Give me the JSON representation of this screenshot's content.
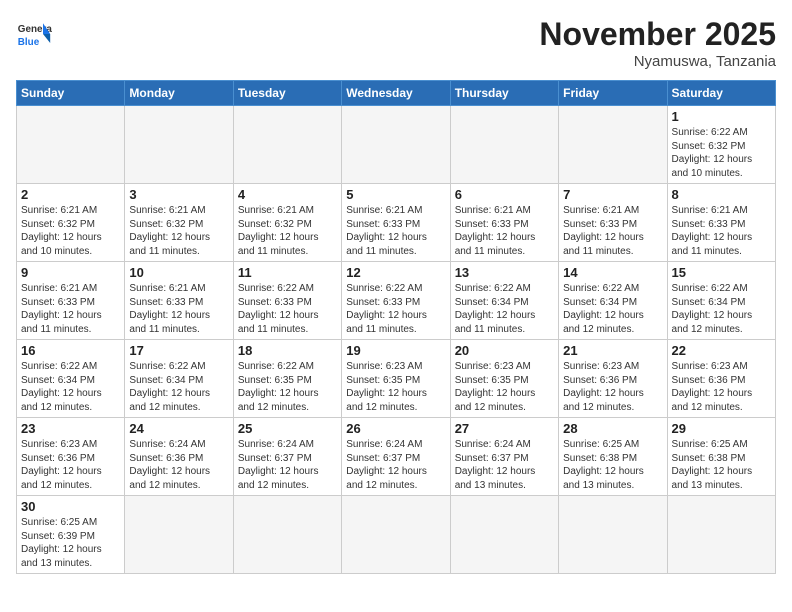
{
  "header": {
    "logo_general": "General",
    "logo_blue": "Blue",
    "month_title": "November 2025",
    "location": "Nyamuswa, Tanzania"
  },
  "weekdays": [
    "Sunday",
    "Monday",
    "Tuesday",
    "Wednesday",
    "Thursday",
    "Friday",
    "Saturday"
  ],
  "weeks": [
    [
      {
        "day": "",
        "info": ""
      },
      {
        "day": "",
        "info": ""
      },
      {
        "day": "",
        "info": ""
      },
      {
        "day": "",
        "info": ""
      },
      {
        "day": "",
        "info": ""
      },
      {
        "day": "",
        "info": ""
      },
      {
        "day": "1",
        "info": "Sunrise: 6:22 AM\nSunset: 6:32 PM\nDaylight: 12 hours and 10 minutes."
      }
    ],
    [
      {
        "day": "2",
        "info": "Sunrise: 6:21 AM\nSunset: 6:32 PM\nDaylight: 12 hours and 10 minutes."
      },
      {
        "day": "3",
        "info": "Sunrise: 6:21 AM\nSunset: 6:32 PM\nDaylight: 12 hours and 11 minutes."
      },
      {
        "day": "4",
        "info": "Sunrise: 6:21 AM\nSunset: 6:32 PM\nDaylight: 12 hours and 11 minutes."
      },
      {
        "day": "5",
        "info": "Sunrise: 6:21 AM\nSunset: 6:33 PM\nDaylight: 12 hours and 11 minutes."
      },
      {
        "day": "6",
        "info": "Sunrise: 6:21 AM\nSunset: 6:33 PM\nDaylight: 12 hours and 11 minutes."
      },
      {
        "day": "7",
        "info": "Sunrise: 6:21 AM\nSunset: 6:33 PM\nDaylight: 12 hours and 11 minutes."
      },
      {
        "day": "8",
        "info": "Sunrise: 6:21 AM\nSunset: 6:33 PM\nDaylight: 12 hours and 11 minutes."
      }
    ],
    [
      {
        "day": "9",
        "info": "Sunrise: 6:21 AM\nSunset: 6:33 PM\nDaylight: 12 hours and 11 minutes."
      },
      {
        "day": "10",
        "info": "Sunrise: 6:21 AM\nSunset: 6:33 PM\nDaylight: 12 hours and 11 minutes."
      },
      {
        "day": "11",
        "info": "Sunrise: 6:22 AM\nSunset: 6:33 PM\nDaylight: 12 hours and 11 minutes."
      },
      {
        "day": "12",
        "info": "Sunrise: 6:22 AM\nSunset: 6:33 PM\nDaylight: 12 hours and 11 minutes."
      },
      {
        "day": "13",
        "info": "Sunrise: 6:22 AM\nSunset: 6:34 PM\nDaylight: 12 hours and 11 minutes."
      },
      {
        "day": "14",
        "info": "Sunrise: 6:22 AM\nSunset: 6:34 PM\nDaylight: 12 hours and 12 minutes."
      },
      {
        "day": "15",
        "info": "Sunrise: 6:22 AM\nSunset: 6:34 PM\nDaylight: 12 hours and 12 minutes."
      }
    ],
    [
      {
        "day": "16",
        "info": "Sunrise: 6:22 AM\nSunset: 6:34 PM\nDaylight: 12 hours and 12 minutes."
      },
      {
        "day": "17",
        "info": "Sunrise: 6:22 AM\nSunset: 6:34 PM\nDaylight: 12 hours and 12 minutes."
      },
      {
        "day": "18",
        "info": "Sunrise: 6:22 AM\nSunset: 6:35 PM\nDaylight: 12 hours and 12 minutes."
      },
      {
        "day": "19",
        "info": "Sunrise: 6:23 AM\nSunset: 6:35 PM\nDaylight: 12 hours and 12 minutes."
      },
      {
        "day": "20",
        "info": "Sunrise: 6:23 AM\nSunset: 6:35 PM\nDaylight: 12 hours and 12 minutes."
      },
      {
        "day": "21",
        "info": "Sunrise: 6:23 AM\nSunset: 6:36 PM\nDaylight: 12 hours and 12 minutes."
      },
      {
        "day": "22",
        "info": "Sunrise: 6:23 AM\nSunset: 6:36 PM\nDaylight: 12 hours and 12 minutes."
      }
    ],
    [
      {
        "day": "23",
        "info": "Sunrise: 6:23 AM\nSunset: 6:36 PM\nDaylight: 12 hours and 12 minutes."
      },
      {
        "day": "24",
        "info": "Sunrise: 6:24 AM\nSunset: 6:36 PM\nDaylight: 12 hours and 12 minutes."
      },
      {
        "day": "25",
        "info": "Sunrise: 6:24 AM\nSunset: 6:37 PM\nDaylight: 12 hours and 12 minutes."
      },
      {
        "day": "26",
        "info": "Sunrise: 6:24 AM\nSunset: 6:37 PM\nDaylight: 12 hours and 12 minutes."
      },
      {
        "day": "27",
        "info": "Sunrise: 6:24 AM\nSunset: 6:37 PM\nDaylight: 12 hours and 13 minutes."
      },
      {
        "day": "28",
        "info": "Sunrise: 6:25 AM\nSunset: 6:38 PM\nDaylight: 12 hours and 13 minutes."
      },
      {
        "day": "29",
        "info": "Sunrise: 6:25 AM\nSunset: 6:38 PM\nDaylight: 12 hours and 13 minutes."
      }
    ],
    [
      {
        "day": "30",
        "info": "Sunrise: 6:25 AM\nSunset: 6:39 PM\nDaylight: 12 hours and 13 minutes."
      },
      {
        "day": "",
        "info": ""
      },
      {
        "day": "",
        "info": ""
      },
      {
        "day": "",
        "info": ""
      },
      {
        "day": "",
        "info": ""
      },
      {
        "day": "",
        "info": ""
      },
      {
        "day": "",
        "info": ""
      }
    ]
  ]
}
